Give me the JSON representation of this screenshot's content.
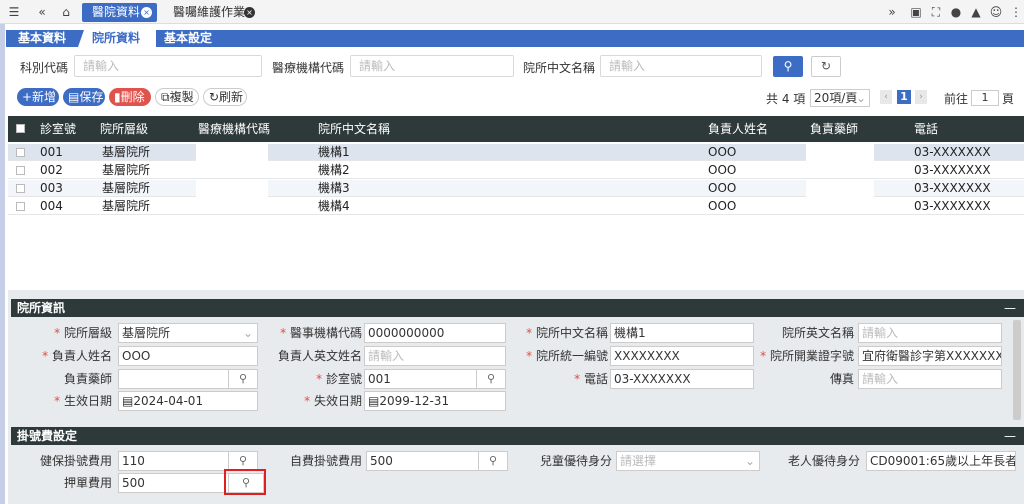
{
  "topbar": {
    "icons_left": [
      "☰",
      "«",
      "⌂"
    ],
    "tabs": [
      {
        "label": "醫院資料",
        "close": "×"
      },
      {
        "label": "醫囑維護作業",
        "close": "×"
      }
    ],
    "icons_right": [
      "»",
      "▣",
      "⛶",
      "●",
      "▲",
      "☺",
      "⋮"
    ]
  },
  "subtabs": [
    "基本資料",
    "院所資料",
    "基本設定"
  ],
  "search": {
    "fields": [
      {
        "label": "科別代碼",
        "placeholder": "請輸入"
      },
      {
        "label": "醫療機構代碼",
        "placeholder": "請輸入"
      },
      {
        "label": "院所中文名稱",
        "placeholder": "請輸入"
      }
    ],
    "search_icon": "⚲",
    "reset_icon": "↻"
  },
  "actions": {
    "add": "+新增",
    "save": "▤保存",
    "delete": "▮刪除",
    "copy": "⧉複製",
    "refresh": "↻刷新"
  },
  "pagination": {
    "total": "共 4 項",
    "page_size": "20項/頁",
    "prev": "‹",
    "current": "1",
    "next": "›",
    "goto_label": "前往",
    "goto_value": "1",
    "page_unit": "頁"
  },
  "table": {
    "headers": [
      "診室號",
      "院所層級",
      "醫療機構代碼",
      "院所中文名稱",
      "負責人姓名",
      "負責藥師",
      "電話"
    ],
    "rows": [
      {
        "room": "001",
        "level": "基層院所",
        "name": "機構1",
        "person": "OOO",
        "phone": "03-XXXXXXX"
      },
      {
        "room": "002",
        "level": "基層院所",
        "name": "機構2",
        "person": "OOO",
        "phone": "03-XXXXXXX"
      },
      {
        "room": "003",
        "level": "基層院所",
        "name": "機構3",
        "person": "OOO",
        "phone": "03-XXXXXXX"
      },
      {
        "room": "004",
        "level": "基層院所",
        "name": "機構4",
        "person": "OOO",
        "phone": "03-XXXXXXX"
      }
    ]
  },
  "info": {
    "title": "院所資訊",
    "minimize": "—",
    "level_label": "院所層級",
    "level_value": "基層院所",
    "code_label": "醫事機構代碼",
    "code_value": "0000000000",
    "cname_label": "院所中文名稱",
    "cname_value": "機構1",
    "ename_label": "院所英文名稱",
    "ename_placeholder": "請輸入",
    "person_label": "負責人姓名",
    "person_value": "OOO",
    "person_en_label": "負責人英文姓名",
    "person_en_placeholder": "請輸入",
    "unified_label": "院所統一編號",
    "unified_value": "XXXXXXXX",
    "license_label": "院所開業證字號",
    "license_value": "宜府衛醫診字第XXXXXXXXX",
    "pharm_label": "負責藥師",
    "pharm_value": "",
    "room_label": "診室號",
    "room_value": "001",
    "phone_label": "電話",
    "phone_value": "03-XXXXXXX",
    "fax_label": "傳真",
    "fax_placeholder": "請輸入",
    "start_label": "生效日期",
    "start_value": "▤2024-04-01",
    "end_label": "失效日期",
    "end_value": "▤2099-12-31",
    "req_mark": "*"
  },
  "fee": {
    "title": "掛號費設定",
    "minimize": "—",
    "nhi_label": "健保掛號費用",
    "nhi_value": "110",
    "self_label": "自費掛號費用",
    "self_value": "500",
    "child_label": "兒童優待身分",
    "child_placeholder": "請選擇",
    "elder_label": "老人優待身分",
    "elder_value": "CD09001:65歲以上年長者優",
    "deposit_label": "押單費用",
    "deposit_value": "500"
  },
  "icons": {
    "search": "⚲",
    "chevron": "⌄"
  }
}
